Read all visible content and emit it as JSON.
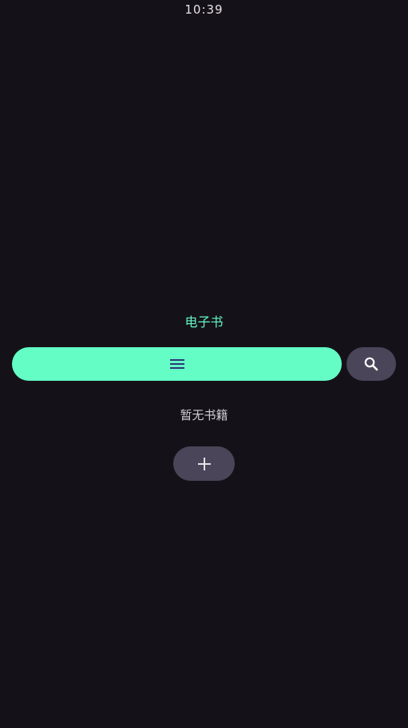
{
  "status_bar": {
    "time": "10:39"
  },
  "header": {
    "title": "电子书"
  },
  "toolbar": {
    "menu_icon": "menu-icon",
    "search_icon": "search-icon"
  },
  "library": {
    "empty_message": "暂无书籍",
    "add_icon": "plus-icon"
  },
  "colors": {
    "background": "#141218",
    "accent": "#64fdc6",
    "accent_text": "#64f7c4",
    "secondary_button": "#4a4558",
    "text_muted": "#d0ccd6"
  }
}
